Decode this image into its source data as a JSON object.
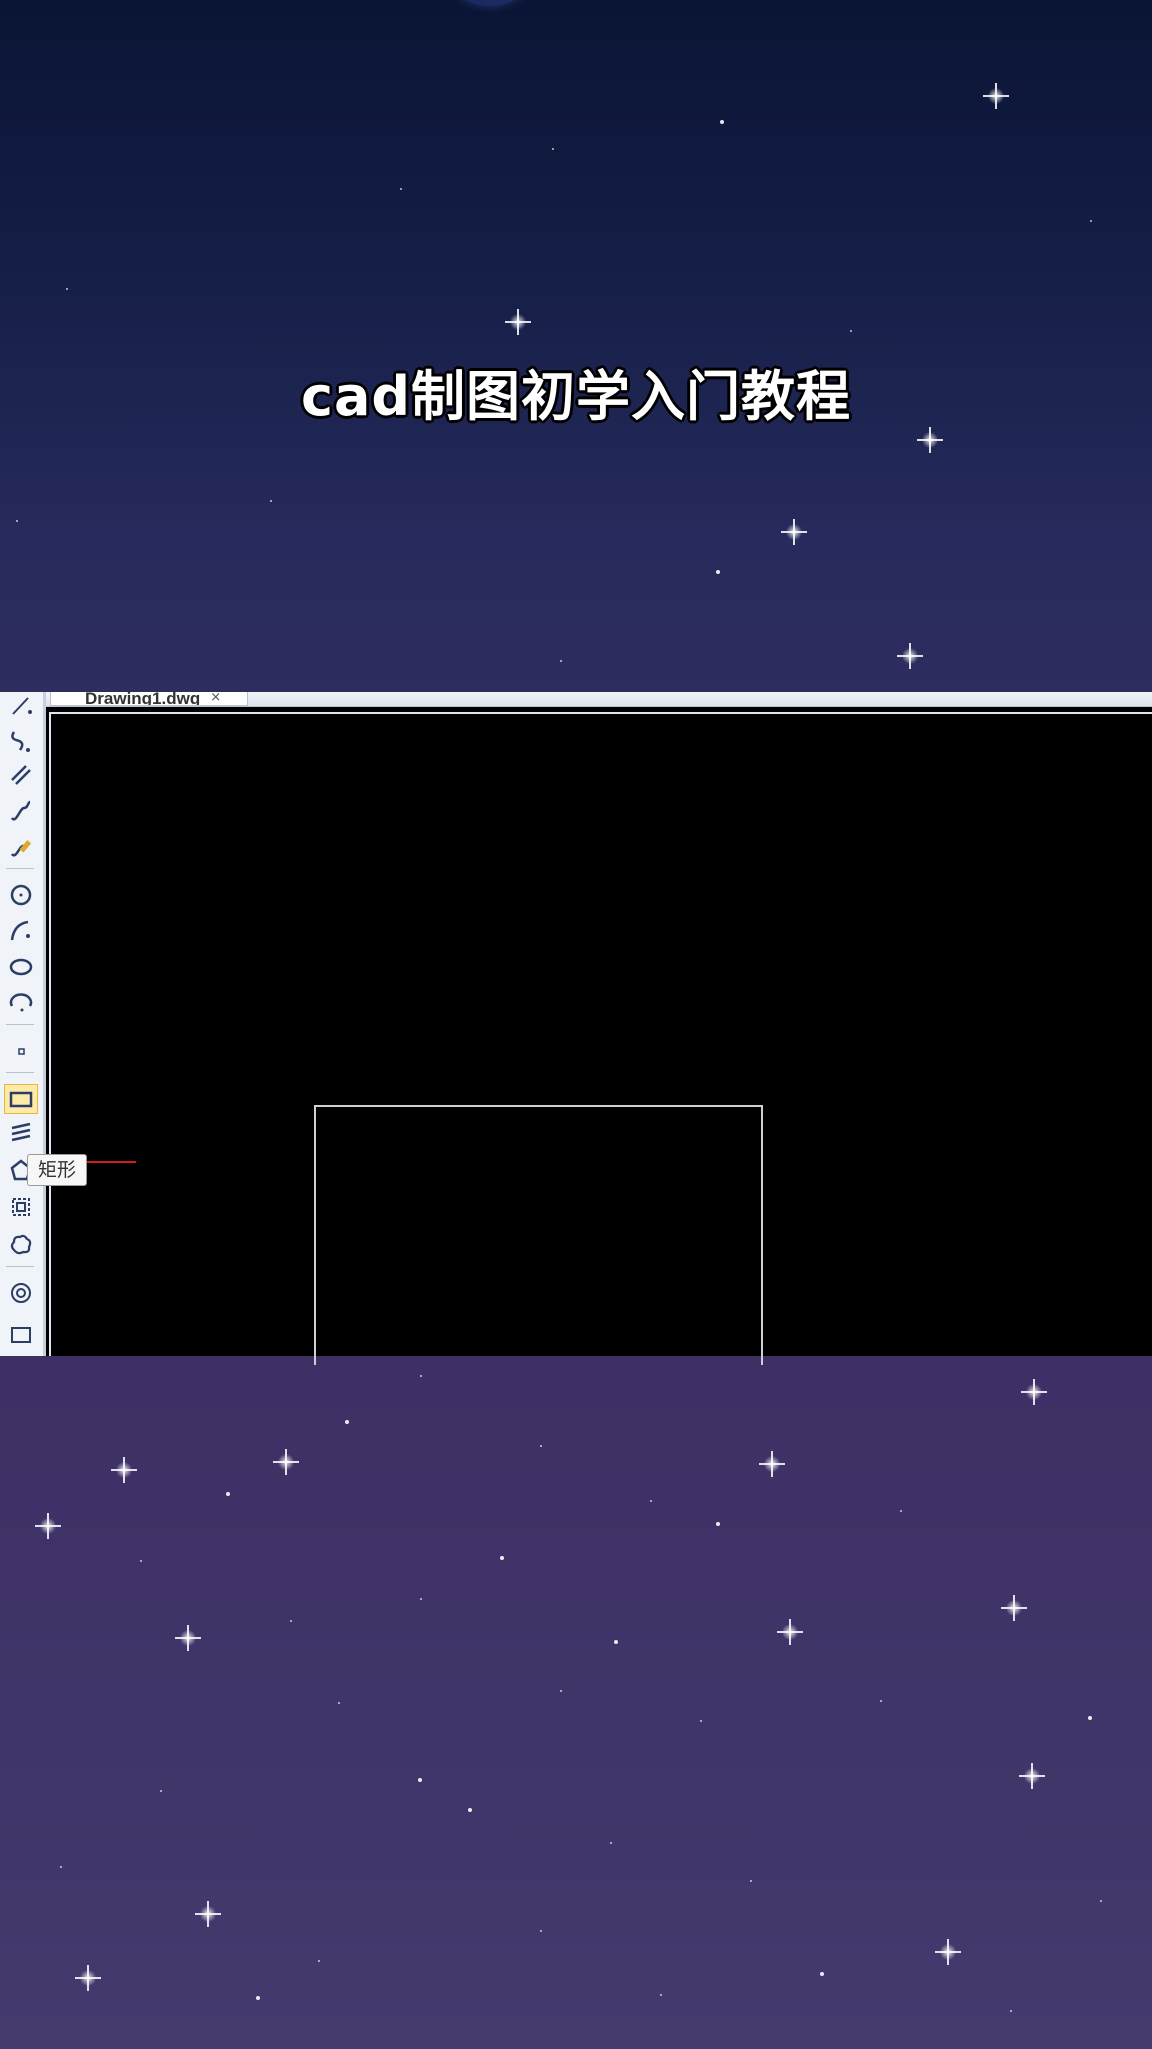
{
  "video": {
    "title": "cad制图初学入门教程"
  },
  "cad": {
    "document_tab": {
      "label": "Drawing1.dwg",
      "close_glyph": "×"
    },
    "canvas_background": "#000000",
    "toolbar_background": "#f0f3f8",
    "tools": [
      {
        "icon": "line-icon"
      },
      {
        "icon": "polyline-icon"
      },
      {
        "icon": "parallel-lines-icon"
      },
      {
        "icon": "spline-icon"
      },
      {
        "icon": "freehand-icon"
      },
      {
        "icon": "circle-icon"
      },
      {
        "icon": "arc-icon"
      },
      {
        "icon": "ellipse-icon"
      },
      {
        "icon": "ellipse-arc-icon"
      },
      {
        "icon": "point-icon"
      },
      {
        "icon": "rectangle-icon",
        "active": true
      },
      {
        "icon": "hatch-icon"
      },
      {
        "icon": "polygon-icon"
      },
      {
        "icon": "region-icon"
      },
      {
        "icon": "revision-cloud-icon"
      },
      {
        "icon": "donut-icon"
      },
      {
        "icon": "wipeout-icon"
      }
    ],
    "tooltip": {
      "text": "矩形"
    },
    "accent_colors": {
      "active_tool": "#fde9a8",
      "shape_stroke": "#cfcfcf",
      "cursor": "#d51a1a"
    }
  }
}
